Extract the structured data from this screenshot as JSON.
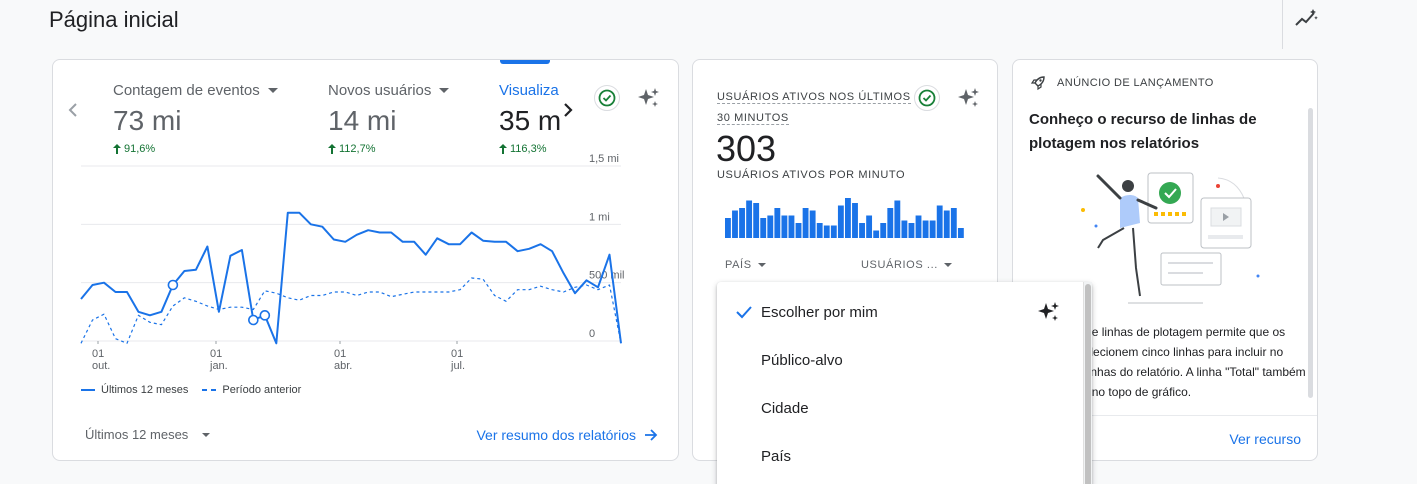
{
  "page": {
    "title": "Página inicial"
  },
  "overview": {
    "metrics": [
      {
        "label": "Contagem de eventos",
        "value": "73 mi",
        "change": "91,6%"
      },
      {
        "label": "Novos usuários",
        "value": "14 mi",
        "change": "112,7%"
      },
      {
        "label": "Visualiza",
        "value": "35 m",
        "change": "116,3%"
      }
    ],
    "legend": {
      "current": "Últimos 12 meses",
      "previous": "Período anterior"
    },
    "range_label": "Últimos 12 meses",
    "link_label": "Ver resumo dos relatórios"
  },
  "chart_data": {
    "type": "line",
    "y_tick_labels": [
      "1,5 mi",
      "1 mi",
      "500 mil",
      "0"
    ],
    "x_tick_labels": [
      {
        "day": "01",
        "month": "out."
      },
      {
        "day": "01",
        "month": "jan."
      },
      {
        "day": "01",
        "month": "abr."
      },
      {
        "day": "01",
        "month": "jul."
      }
    ],
    "ylim": [
      0,
      1500000
    ],
    "grid": true,
    "legend_position": "bottom",
    "series": [
      {
        "name": "Últimos 12 meses",
        "style": "solid",
        "color": "#1a73e8",
        "values": [
          360000,
          480000,
          500000,
          420000,
          420000,
          250000,
          220000,
          250000,
          480000,
          600000,
          610000,
          810000,
          250000,
          730000,
          780000,
          180000,
          220000,
          -20000,
          1100000,
          1100000,
          1000000,
          980000,
          870000,
          850000,
          910000,
          950000,
          930000,
          930000,
          850000,
          850000,
          740000,
          880000,
          830000,
          830000,
          930000,
          860000,
          850000,
          850000,
          770000,
          790000,
          830000,
          770000,
          580000,
          410000,
          520000,
          460000,
          740000,
          -20000
        ]
      },
      {
        "name": "Período anterior",
        "style": "dashed",
        "color": "#1a73e8",
        "values": [
          -20000,
          180000,
          230000,
          20000,
          -20000,
          220000,
          160000,
          140000,
          300000,
          370000,
          340000,
          300000,
          270000,
          290000,
          290000,
          270000,
          430000,
          410000,
          370000,
          350000,
          390000,
          390000,
          420000,
          420000,
          390000,
          420000,
          420000,
          380000,
          400000,
          420000,
          420000,
          420000,
          420000,
          440000,
          540000,
          530000,
          390000,
          340000,
          440000,
          440000,
          470000,
          440000,
          420000,
          460000,
          480000,
          440000,
          480000,
          -20000
        ]
      }
    ]
  },
  "realtime": {
    "title": "USUÁRIOS ATIVOS NOS ÚLTIMOS 30 MINUTOS",
    "value": "303",
    "subtitle": "USUÁRIOS ATIVOS POR MINUTO",
    "col1": "PAÍS",
    "col2": "USUÁRIOS ..."
  },
  "realtime_bars": [
    0.4,
    0.55,
    0.6,
    0.75,
    0.7,
    0.4,
    0.45,
    0.6,
    0.45,
    0.45,
    0.3,
    0.6,
    0.55,
    0.3,
    0.25,
    0.25,
    0.65,
    0.8,
    0.7,
    0.3,
    0.45,
    0.15,
    0.3,
    0.6,
    0.75,
    0.35,
    0.3,
    0.45,
    0.35,
    0.35,
    0.65,
    0.55,
    0.6,
    0.2
  ],
  "launch": {
    "label": "ANÚNCIO DE LANÇAMENTO",
    "title": "Conheço o recurso de linhas de plotagem nos relatórios",
    "body": "O recurso de linhas de plotagem permite que os usuários selecionem cinco linhas para incluir no gráfico de linhas do relatório. A linha \"Total\" também está visível no topo de gráfico.",
    "link": "Ver recurso"
  },
  "dropdown": {
    "items": [
      {
        "label": "Escolher por mim",
        "selected": true
      },
      {
        "label": "Público-alvo",
        "selected": false
      },
      {
        "label": "Cidade",
        "selected": false
      },
      {
        "label": "País",
        "selected": false
      }
    ]
  },
  "colors": {
    "accent": "#1a73e8",
    "positive": "#137333",
    "check": "#188038"
  }
}
